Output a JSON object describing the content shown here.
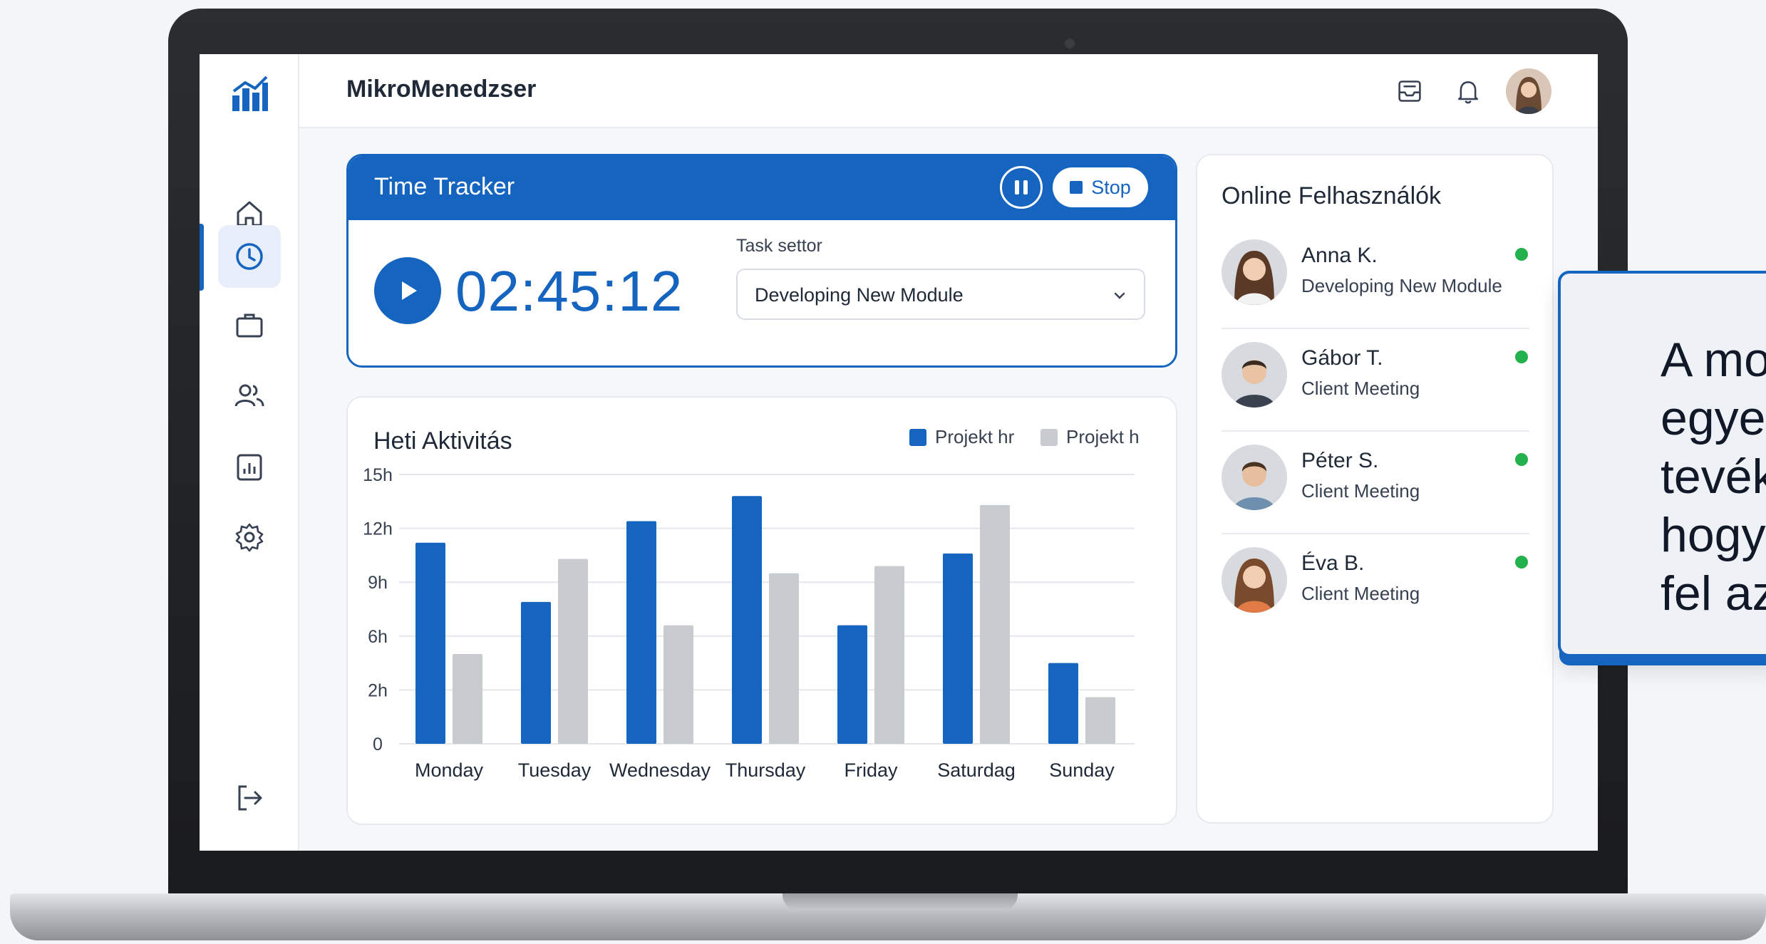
{
  "app": {
    "title": "MikroMenedzser"
  },
  "colors": {
    "primary": "#1565c0",
    "secondary_bar": "#c8cbd0",
    "online": "#22b14c"
  },
  "sidebar": {
    "items": [
      {
        "icon": "home-icon",
        "active": false
      },
      {
        "icon": "clock-icon",
        "active": true
      },
      {
        "icon": "briefcase-icon",
        "active": false
      },
      {
        "icon": "users-icon",
        "active": false
      },
      {
        "icon": "report-icon",
        "active": false
      },
      {
        "icon": "gear-icon",
        "active": false
      }
    ],
    "bottom_icon": "logout-icon"
  },
  "topbar": {
    "icons": [
      "inbox-icon",
      "bell-icon",
      "avatar"
    ]
  },
  "tracker": {
    "title": "Time Tracker",
    "stop_label": "Stop",
    "time": "02:45:12",
    "task_label": "Task settor",
    "task_value": "Developing New Module"
  },
  "activity": {
    "title": "Heti Aktivitás",
    "legend": [
      "Projekt hr",
      "Projekt h"
    ]
  },
  "chart_data": {
    "type": "bar",
    "title": "Heti Aktivitás",
    "categories": [
      "Monday",
      "Tuesday",
      "Wednesday",
      "Thursday",
      "Friday",
      "Saturdag",
      "Sunday"
    ],
    "series": [
      {
        "name": "Projekt hr",
        "color": "#1565c0",
        "values": [
          11.2,
          7.9,
          12.4,
          13.8,
          6.6,
          10.6,
          4.5
        ]
      },
      {
        "name": "Projekt h",
        "color": "#c8cbd0",
        "values": [
          5,
          10.3,
          6.6,
          9.5,
          9.9,
          13.3,
          2.6
        ]
      }
    ],
    "y_ticks": [
      "15h",
      "12h",
      "9h",
      "6h",
      "2h",
      "0"
    ],
    "ylim": [
      0,
      15
    ],
    "grid": true,
    "legend_position": "top-right"
  },
  "users": {
    "title": "Online Felhasználók",
    "list": [
      {
        "name": "Anna K.",
        "task": "Developing New Module"
      },
      {
        "name": "Gábor T.",
        "task": "Client Meeting"
      },
      {
        "name": "Péter S.",
        "task": "Client Meeting"
      },
      {
        "name": "Éva B.",
        "task": "Client Meeting"
      }
    ]
  },
  "callout": {
    "lines": [
      "A mo",
      "egyes",
      "tevék",
      "hogy",
      "fel az"
    ]
  }
}
